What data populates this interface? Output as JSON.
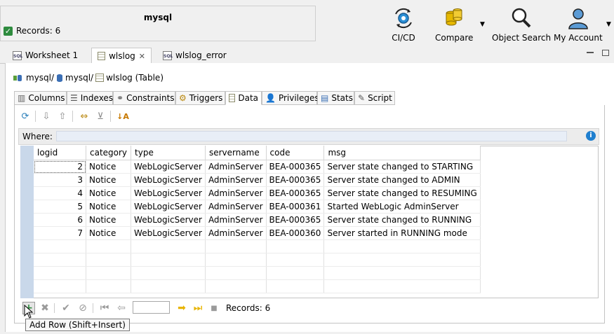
{
  "status": {
    "connection_name": "mysql",
    "records_text": "Records: 6"
  },
  "toolbar": {
    "cicd_label": "CI/CD",
    "compare_label": "Compare",
    "object_search_label": "Object Search",
    "my_account_label": "My Account"
  },
  "tabs": [
    {
      "label": "Worksheet 1"
    },
    {
      "label": "wlslog"
    },
    {
      "label": "wlslog_error"
    }
  ],
  "breadcrumb": {
    "part1": "mysql/",
    "part2": "mysql/",
    "part3": "wlslog (Table)"
  },
  "subtabs": [
    {
      "label": "Columns"
    },
    {
      "label": "Indexes"
    },
    {
      "label": "Constraints"
    },
    {
      "label": "Triggers"
    },
    {
      "label": "Data"
    },
    {
      "label": "Privileges"
    },
    {
      "label": "Stats"
    },
    {
      "label": "Script"
    }
  ],
  "where": {
    "label": "Where:",
    "value": ""
  },
  "grid": {
    "columns": [
      "logid",
      "category",
      "type",
      "servername",
      "code",
      "msg"
    ],
    "rows": [
      [
        "2",
        "Notice",
        "WebLogicServer",
        "AdminServer",
        "BEA-000365",
        "Server state changed to STARTING"
      ],
      [
        "3",
        "Notice",
        "WebLogicServer",
        "AdminServer",
        "BEA-000365",
        "Server state changed to ADMIN"
      ],
      [
        "4",
        "Notice",
        "WebLogicServer",
        "AdminServer",
        "BEA-000365",
        "Server state changed to RESUMING"
      ],
      [
        "5",
        "Notice",
        "WebLogicServer",
        "AdminServer",
        "BEA-000361",
        "Started WebLogic AdminServer"
      ],
      [
        "6",
        "Notice",
        "WebLogicServer",
        "AdminServer",
        "BEA-000365",
        "Server state changed to RUNNING"
      ],
      [
        "7",
        "Notice",
        "WebLogicServer",
        "AdminServer",
        "BEA-000360",
        "Server started in RUNNING mode"
      ]
    ]
  },
  "nav": {
    "page_value": "",
    "records_text": "Records: 6"
  },
  "tooltip": {
    "text": "Add Row (Shift+Insert)"
  },
  "colors": {
    "accent_blue": "#1f7fcf",
    "check_green": "#2e8b3e",
    "gutter": "#c9d8ea",
    "arrow_yellow": "#e8b400"
  }
}
